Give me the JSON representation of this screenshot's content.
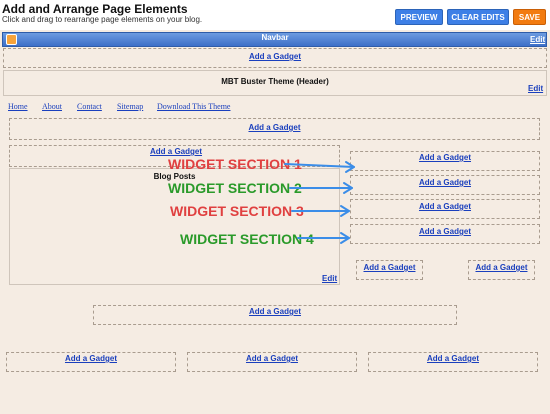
{
  "header": {
    "title": "Add and Arrange Page Elements",
    "subtitle": "Click and drag to rearrange page elements on your blog."
  },
  "toolbar": {
    "preview": "PREVIEW",
    "clear": "CLEAR EDITS",
    "save": "SAVE"
  },
  "navbar": {
    "label": "Navbar",
    "edit": "Edit"
  },
  "gadget": {
    "add": "Add a Gadget",
    "edit": "Edit"
  },
  "header_section": {
    "label": "MBT Buster Theme (Header)",
    "edit": "Edit"
  },
  "nav_links": [
    "Home",
    "About",
    "Contact",
    "Sitemap",
    "Download This Theme"
  ],
  "blog_posts": {
    "label": "Blog Posts",
    "edit": "Edit"
  },
  "annotations": [
    {
      "text": "WIDGET SECTION 1",
      "color": "#e04040"
    },
    {
      "text": "WIDGET SECTION 2",
      "color": "#2a9a2a"
    },
    {
      "text": "WIDGET SECTION 3",
      "color": "#e04040"
    },
    {
      "text": "WIDGET SECTION 4",
      "color": "#2a9a2a"
    }
  ],
  "colors": {
    "accent_blue": "#3d7fe6",
    "save_orange": "#f27b10",
    "canvas": "#f5ece3",
    "arrow": "#3b8de8"
  }
}
